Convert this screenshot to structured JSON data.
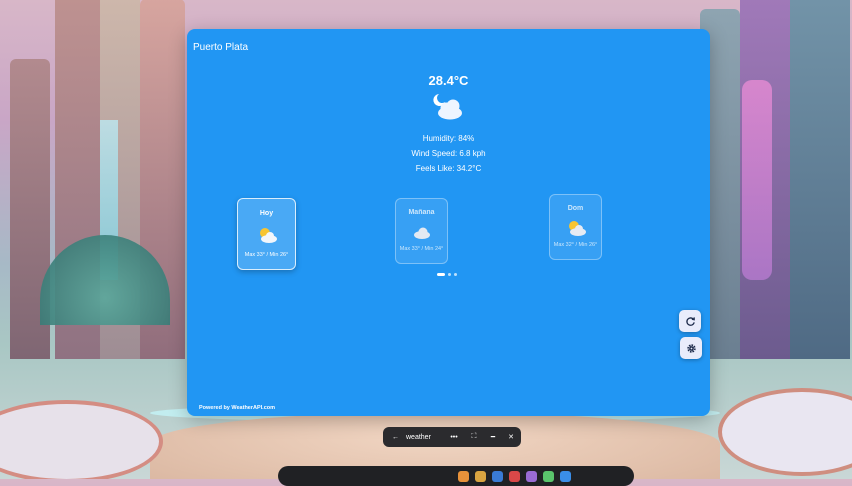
{
  "city": "Puerto Plata",
  "current": {
    "temperature": "28.4°C",
    "condition_icon": "night-partly-cloudy-icon",
    "humidity": "Humidity: 84%",
    "wind_speed": "Wind Speed: 6.8 kph",
    "feels_like": "Feels Like: 34.2°C"
  },
  "forecast": [
    {
      "day": "Hoy",
      "icon": "sunny-cloudy-icon",
      "minmax": "Max 33° / Min 26°"
    },
    {
      "day": "Mañana",
      "icon": "cloudy-icon",
      "minmax": "Max 33° / Min 24°"
    },
    {
      "day": "Dom",
      "icon": "sunny-cloudy-icon",
      "minmax": "Max 32° / Min 26°"
    }
  ],
  "powered_by": "Powered by WeatherAPI.com",
  "window_bar": {
    "back": "←",
    "title": "weather",
    "more": "•••",
    "expand": "⛶",
    "minimize": "━",
    "close": "✕"
  },
  "colors": {
    "panel": "#2196f3",
    "fab": "#e9ecfb",
    "window_bar": "#2b2b2e"
  },
  "dock_apps": [
    "#e8923a",
    "#d9a441",
    "#3a7bd5",
    "#d94848",
    "#9a6bd4",
    "#5ac46c",
    "#3a8ee8"
  ]
}
